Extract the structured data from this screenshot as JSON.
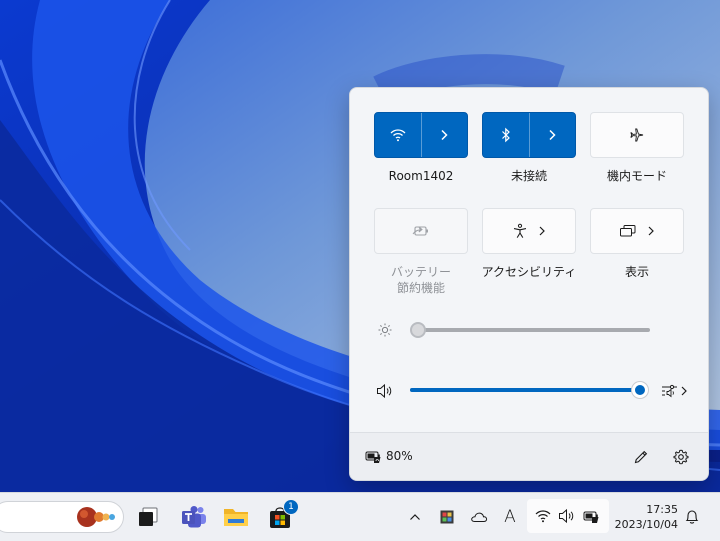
{
  "quick_settings": {
    "tiles": [
      {
        "label": "Room1402",
        "state": "on",
        "icon": "wifi-icon"
      },
      {
        "label": "未接続",
        "state": "on",
        "icon": "bluetooth-icon"
      },
      {
        "label": "機内モード",
        "state": "off",
        "icon": "airplane-icon"
      },
      {
        "label_line1": "バッテリー",
        "label_line2": "節約機能",
        "state": "disabled",
        "icon": "battery-saver-icon"
      },
      {
        "label": "アクセシビリティ",
        "state": "off",
        "icon": "accessibility-icon"
      },
      {
        "label": "表示",
        "state": "off",
        "icon": "cast-display-icon"
      }
    ],
    "brightness": {
      "icon": "brightness-icon",
      "level": 0.0
    },
    "volume": {
      "icon": "speaker-icon",
      "level": 1.0
    },
    "footer": {
      "battery_text": "80%",
      "battery_icon": "battery-charging-icon",
      "edit_icon": "pencil-icon",
      "settings_icon": "gear-icon"
    }
  },
  "taskbar": {
    "store_badge": "1",
    "time": "17:35",
    "date": "2023/10/04",
    "ime_indicator": "A"
  },
  "colors": {
    "accent": "#0067c0",
    "panel": "#f3f5f8",
    "taskbar": "#eef0f4"
  }
}
